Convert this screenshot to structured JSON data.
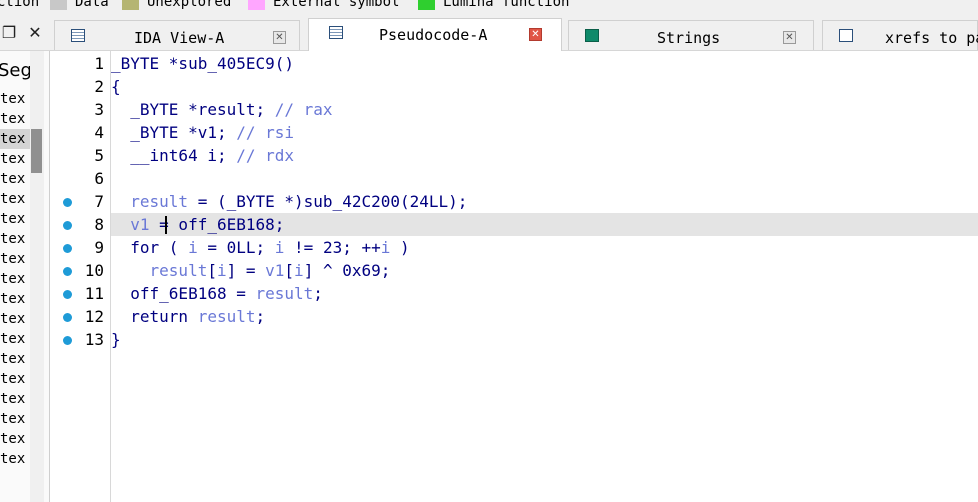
{
  "legend": {
    "items": [
      {
        "label": "ction",
        "color": ""
      },
      {
        "label": "Data",
        "color": "#c8c8c8"
      },
      {
        "label": "Unexplored",
        "color": "#b5b572"
      },
      {
        "label": "External symbol",
        "color": "#ffa6ff"
      },
      {
        "label": "Lumina function",
        "color": "#2fcf2f"
      }
    ]
  },
  "tabs": [
    {
      "label": "IDA View-A",
      "icon": "ida-view-icon",
      "active": false
    },
    {
      "label": "Pseudocode-A",
      "icon": "pseudocode-icon",
      "active": true
    },
    {
      "label": "Strings",
      "icon": "strings-icon",
      "active": false
    },
    {
      "label": "xrefs to pa",
      "icon": "xrefs-icon",
      "active": false
    }
  ],
  "left_pane": {
    "header": "Seg",
    "rows": [
      "tex",
      "tex",
      "tex",
      "tex",
      "tex",
      "tex",
      "tex",
      "tex",
      "tex",
      "tex",
      "tex",
      "tex",
      "tex",
      "tex",
      "tex",
      "tex",
      "tex",
      "tex",
      "tex"
    ]
  },
  "code": {
    "lines": [
      {
        "num": "1",
        "bp": false,
        "tokens": [
          {
            "t": "_BYTE *sub_405EC9()",
            "c": "kw"
          }
        ]
      },
      {
        "num": "2",
        "bp": false,
        "tokens": [
          {
            "t": "{",
            "c": "kw"
          }
        ]
      },
      {
        "num": "3",
        "bp": false,
        "tokens": [
          {
            "t": "  _BYTE *result; ",
            "c": "kw"
          },
          {
            "t": "// rax",
            "c": "com"
          }
        ]
      },
      {
        "num": "4",
        "bp": false,
        "tokens": [
          {
            "t": "  _BYTE *v1; ",
            "c": "kw"
          },
          {
            "t": "// rsi",
            "c": "com"
          }
        ]
      },
      {
        "num": "5",
        "bp": false,
        "tokens": [
          {
            "t": "  __int64 i; ",
            "c": "kw"
          },
          {
            "t": "// rdx",
            "c": "com"
          }
        ]
      },
      {
        "num": "6",
        "bp": false,
        "tokens": []
      },
      {
        "num": "7",
        "bp": true,
        "tokens": [
          {
            "t": "  ",
            "c": "kw"
          },
          {
            "t": "result",
            "c": "var"
          },
          {
            "t": " = (_BYTE *)sub_42C200(24LL);",
            "c": "kw"
          }
        ]
      },
      {
        "num": "8",
        "bp": true,
        "tokens": [
          {
            "t": "  ",
            "c": "kw"
          },
          {
            "t": "v1",
            "c": "var"
          },
          {
            "t": " = off_6EB168;",
            "c": "kw"
          }
        ]
      },
      {
        "num": "9",
        "bp": true,
        "tokens": [
          {
            "t": "  for ( ",
            "c": "kw"
          },
          {
            "t": "i",
            "c": "var"
          },
          {
            "t": " = 0LL; ",
            "c": "kw"
          },
          {
            "t": "i",
            "c": "var"
          },
          {
            "t": " != 23; ++",
            "c": "kw"
          },
          {
            "t": "i",
            "c": "var"
          },
          {
            "t": " )",
            "c": "kw"
          }
        ]
      },
      {
        "num": "10",
        "bp": true,
        "tokens": [
          {
            "t": "    ",
            "c": "kw"
          },
          {
            "t": "result",
            "c": "var"
          },
          {
            "t": "[",
            "c": "kw"
          },
          {
            "t": "i",
            "c": "var"
          },
          {
            "t": "] = ",
            "c": "kw"
          },
          {
            "t": "v1",
            "c": "var"
          },
          {
            "t": "[",
            "c": "kw"
          },
          {
            "t": "i",
            "c": "var"
          },
          {
            "t": "] ^ 0x69;",
            "c": "kw"
          }
        ]
      },
      {
        "num": "11",
        "bp": true,
        "tokens": [
          {
            "t": "  off_6EB168 = ",
            "c": "kw"
          },
          {
            "t": "result",
            "c": "var"
          },
          {
            "t": ";",
            "c": "kw"
          }
        ]
      },
      {
        "num": "12",
        "bp": true,
        "tokens": [
          {
            "t": "  return ",
            "c": "kw"
          },
          {
            "t": "result",
            "c": "var"
          },
          {
            "t": ";",
            "c": "kw"
          }
        ]
      },
      {
        "num": "13",
        "bp": true,
        "tokens": [
          {
            "t": "}",
            "c": "kw"
          }
        ]
      }
    ],
    "highlight_line": 8
  }
}
